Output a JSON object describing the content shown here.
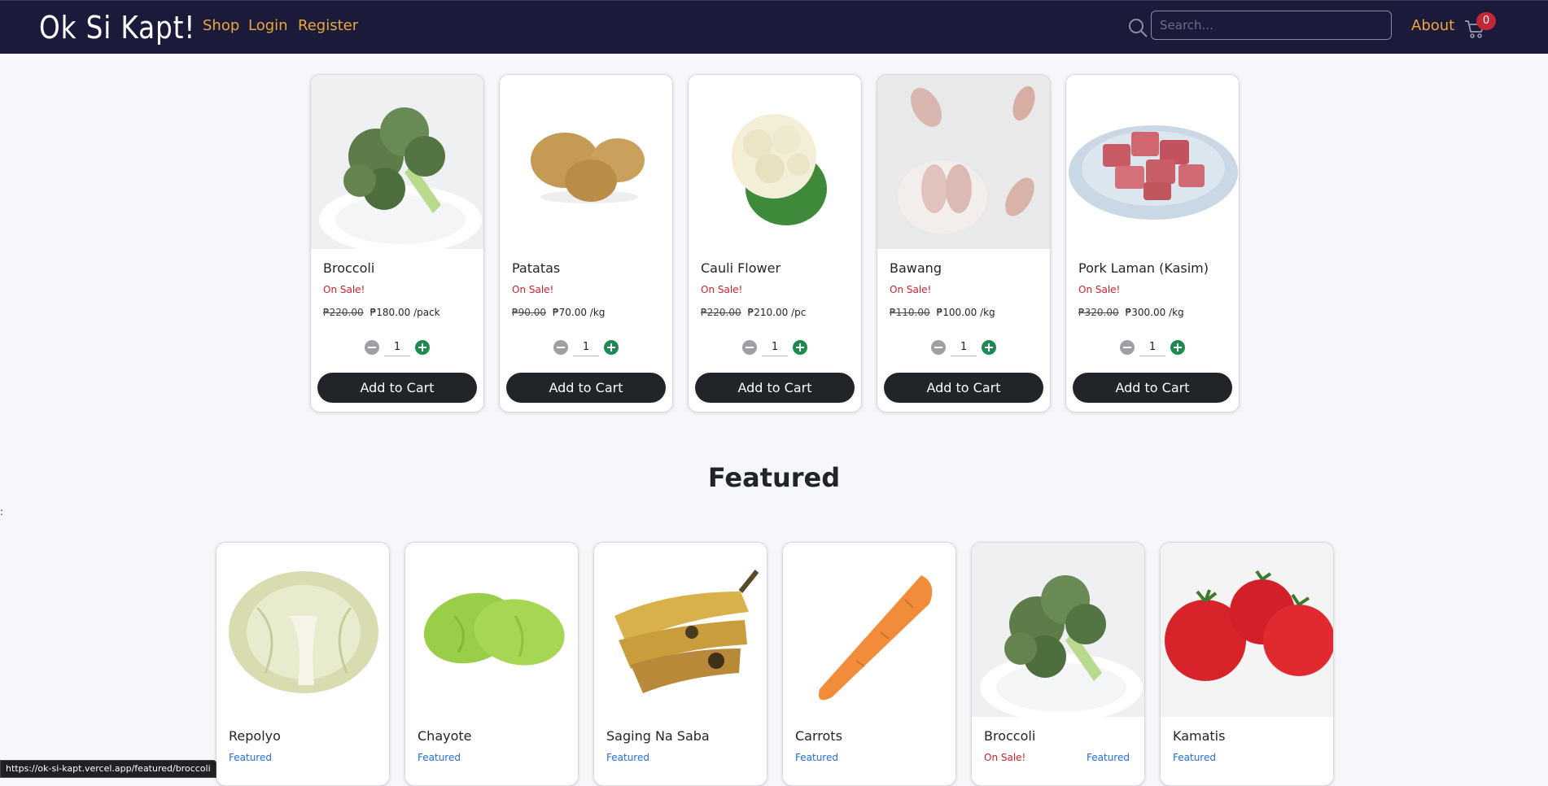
{
  "navbar": {
    "brand": "Ok Si Kapt!",
    "links": [
      "Shop",
      "Login",
      "Register"
    ],
    "search_placeholder": "Search...",
    "about": "About",
    "cart_count": "0"
  },
  "sale_products": [
    {
      "name": "Broccoli",
      "tag": "On Sale!",
      "old_price": "₱220.00",
      "price": "₱180.00 /pack",
      "qty": "1",
      "button": "Add to Cart",
      "image": "broccoli"
    },
    {
      "name": "Patatas",
      "tag": "On Sale!",
      "old_price": "₱90.00",
      "price": "₱70.00 /kg",
      "qty": "1",
      "button": "Add to Cart",
      "image": "potatoes"
    },
    {
      "name": "Cauli Flower",
      "tag": "On Sale!",
      "old_price": "₱220.00",
      "price": "₱210.00 /pc",
      "qty": "1",
      "button": "Add to Cart",
      "image": "cauliflower"
    },
    {
      "name": "Bawang",
      "tag": "On Sale!",
      "old_price": "₱110.00",
      "price": "₱100.00 /kg",
      "qty": "1",
      "button": "Add to Cart",
      "image": "garlic"
    },
    {
      "name": "Pork Laman (Kasim)",
      "tag": "On Sale!",
      "old_price": "₱320.00",
      "price": "₱300.00 /kg",
      "qty": "1",
      "button": "Add to Cart",
      "image": "pork"
    }
  ],
  "featured_heading": "Featured",
  "featured_products": [
    {
      "name": "Repolyo",
      "sale": "",
      "tag": "Featured",
      "image": "cabbage"
    },
    {
      "name": "Chayote",
      "sale": "",
      "tag": "Featured",
      "image": "chayote"
    },
    {
      "name": "Saging Na Saba",
      "sale": "",
      "tag": "Featured",
      "image": "banana"
    },
    {
      "name": "Carrots",
      "sale": "",
      "tag": "Featured",
      "image": "carrot"
    },
    {
      "name": "Broccoli",
      "sale": "On Sale!",
      "tag": "Featured",
      "image": "broccoli"
    },
    {
      "name": "Kamatis",
      "sale": "",
      "tag": "Featured",
      "image": "tomato"
    }
  ],
  "stray_char": ":",
  "status_url": "https://ok-si-kapt.vercel.app/featured/broccoli",
  "colors": {
    "navbar": "#1b1a3a",
    "nav_link": "#e8a93a",
    "sale_red": "#d0202e",
    "featured_blue": "#1f6fe0",
    "button_dark": "#212529"
  }
}
